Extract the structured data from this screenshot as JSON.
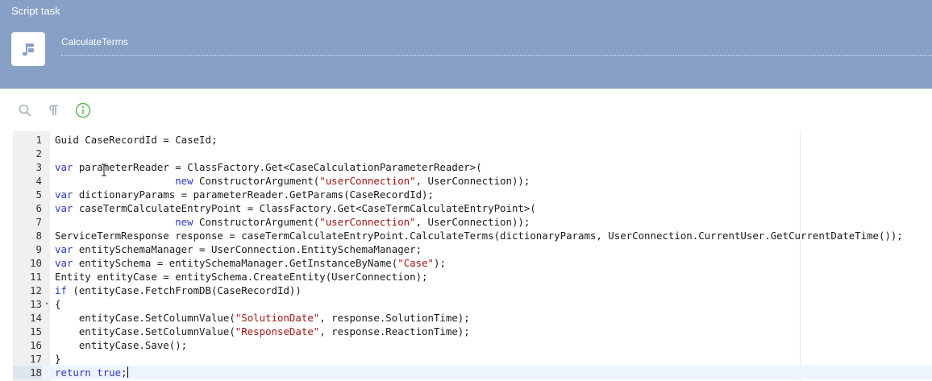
{
  "header": {
    "title": "Script task",
    "name_value": "CalculateTerms"
  },
  "toolbar": {
    "buttons": [
      {
        "name": "search-button",
        "icon": "search-icon"
      },
      {
        "name": "show-invisibles-button",
        "icon": "pilcrow-icon"
      },
      {
        "name": "info-button",
        "icon": "info-icon"
      }
    ]
  },
  "editor": {
    "active_line": 18,
    "lines": [
      {
        "n": "1",
        "tokens": [
          {
            "t": "Guid CaseRecordId = CaseId;"
          }
        ]
      },
      {
        "n": "2",
        "tokens": []
      },
      {
        "n": "3",
        "tokens": [
          {
            "t": "var",
            "k": "kw"
          },
          {
            "t": " parameterReader = ClassFactory.Get<CaseCalculationParameterReader>("
          }
        ]
      },
      {
        "n": "4",
        "tokens": [
          {
            "t": "                    "
          },
          {
            "t": "new",
            "k": "kw"
          },
          {
            "t": " ConstructorArgument("
          },
          {
            "t": "\"userConnection\"",
            "k": "str"
          },
          {
            "t": ", UserConnection));"
          }
        ]
      },
      {
        "n": "5",
        "tokens": [
          {
            "t": "var",
            "k": "kw"
          },
          {
            "t": " dictionaryParams = parameterReader.GetParams(CaseRecordId);"
          }
        ]
      },
      {
        "n": "6",
        "tokens": [
          {
            "t": "var",
            "k": "kw"
          },
          {
            "t": " caseTermCalculateEntryPoint = ClassFactory.Get<CaseTermCalculateEntryPoint>("
          }
        ]
      },
      {
        "n": "7",
        "tokens": [
          {
            "t": "                    "
          },
          {
            "t": "new",
            "k": "kw"
          },
          {
            "t": " ConstructorArgument("
          },
          {
            "t": "\"userConnection\"",
            "k": "str"
          },
          {
            "t": ", UserConnection));"
          }
        ]
      },
      {
        "n": "8",
        "tokens": [
          {
            "t": "ServiceTermResponse response = caseTermCalculateEntryPoint.CalculateTerms(dictionaryParams, UserConnection.CurrentUser.GetCurrentDateTime());"
          }
        ]
      },
      {
        "n": "9",
        "tokens": [
          {
            "t": "var",
            "k": "kw"
          },
          {
            "t": " entitySchemaManager = UserConnection.EntitySchemaManager;"
          }
        ]
      },
      {
        "n": "10",
        "tokens": [
          {
            "t": "var",
            "k": "kw"
          },
          {
            "t": " entitySchema = entitySchemaManager.GetInstanceByName("
          },
          {
            "t": "\"Case\"",
            "k": "str"
          },
          {
            "t": ");"
          }
        ]
      },
      {
        "n": "11",
        "tokens": [
          {
            "t": "Entity entityCase = entitySchema.CreateEntity(UserConnection);"
          }
        ]
      },
      {
        "n": "12",
        "tokens": [
          {
            "t": "if",
            "k": "kw"
          },
          {
            "t": " (entityCase.FetchFromDB(CaseRecordId))"
          }
        ]
      },
      {
        "n": "13",
        "fold": true,
        "tokens": [
          {
            "t": "{"
          }
        ]
      },
      {
        "n": "14",
        "tokens": [
          {
            "t": "    entityCase.SetColumnValue("
          },
          {
            "t": "\"SolutionDate\"",
            "k": "str"
          },
          {
            "t": ", response.SolutionTime);"
          }
        ]
      },
      {
        "n": "15",
        "tokens": [
          {
            "t": "    entityCase.SetColumnValue("
          },
          {
            "t": "\"ResponseDate\"",
            "k": "str"
          },
          {
            "t": ", response.ReactionTime);"
          }
        ]
      },
      {
        "n": "16",
        "tokens": [
          {
            "t": "    entityCase.Save();"
          }
        ]
      },
      {
        "n": "17",
        "tokens": [
          {
            "t": "}"
          }
        ]
      },
      {
        "n": "18",
        "cursor": true,
        "tokens": [
          {
            "t": "return",
            "k": "kw"
          },
          {
            "t": " "
          },
          {
            "t": "true",
            "k": "kw"
          },
          {
            "t": ";"
          }
        ]
      }
    ]
  },
  "colors": {
    "header_bg": "#87a0c6",
    "keyword": "#2a36c8",
    "string": "#a31515",
    "info_green": "#5cb85c"
  }
}
